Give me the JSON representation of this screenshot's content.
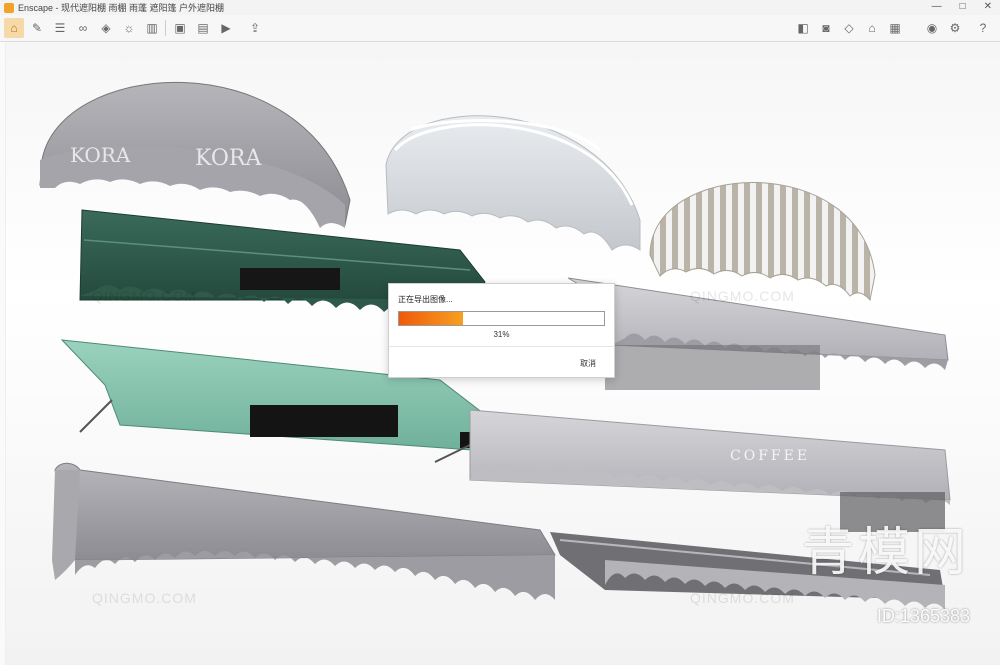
{
  "window": {
    "title": "Enscape - 现代遮阳棚 雨棚 雨蓬 遮阳篷 户外遮阳棚",
    "controls": [
      "—",
      "□",
      "✕"
    ]
  },
  "toolbar": {
    "left_icons": [
      "home-icon",
      "tools-icon",
      "bim-icon",
      "binoculars-icon",
      "compass-icon",
      "sun-icon",
      "building-icon",
      "flag-icon",
      "render-export-icon",
      "batch-export-icon",
      "video-export-icon",
      "upload-icon"
    ],
    "right_icons": [
      "material-icon",
      "capture-icon",
      "cube-icon",
      "house-icon",
      "chart-icon",
      "visual-settings-icon",
      "settings-icon",
      "help-icon"
    ]
  },
  "export_dialog": {
    "title": "正在导出图像...",
    "progress_percent": 31,
    "progress_text": "31%",
    "cancel_label": "取消"
  },
  "awning_labels": {
    "dome_text": "KORA",
    "coffee_text": "COFFEE"
  },
  "watermarks": {
    "site": "QINGMO.COM",
    "brand": "青模网",
    "id": "ID:1365383"
  },
  "colors": {
    "accent": "#f0a22b",
    "progress_start": "#f05a0a",
    "progress_end": "#f7a020",
    "dark_green": "#2f5a4a",
    "mint": "#7fbfa8",
    "gray_fabric": "#9a9aa0"
  }
}
